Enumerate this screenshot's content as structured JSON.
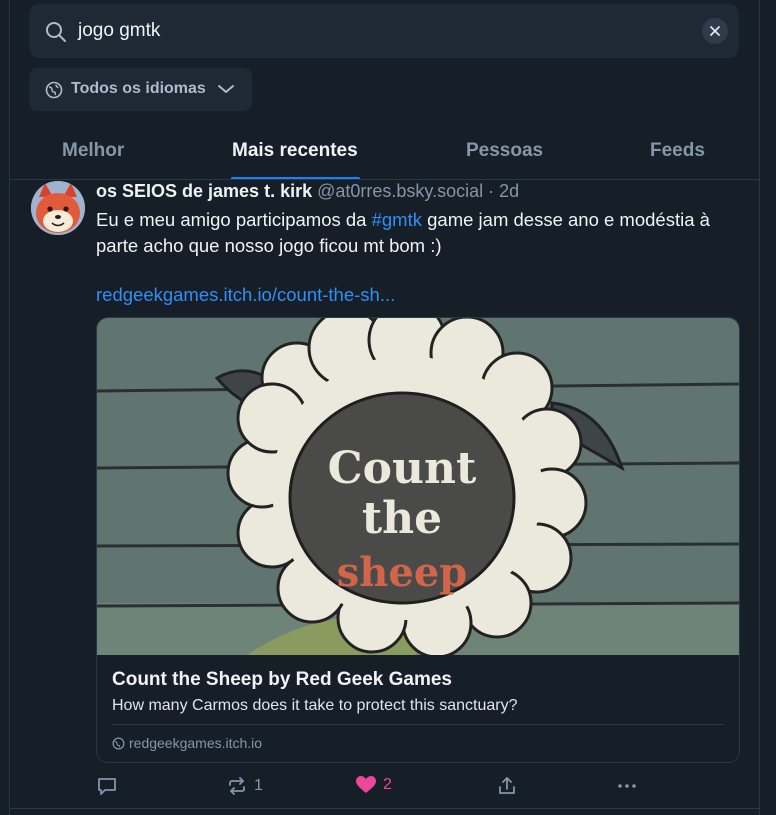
{
  "search": {
    "query": "jogo gmtk",
    "icon": "search-icon",
    "clear_icon": "close-icon"
  },
  "language_filter": {
    "label": "Todos os idiomas",
    "icon": "language-globe-icon"
  },
  "tabs": [
    {
      "label": "Melhor",
      "active": false
    },
    {
      "label": "Mais recentes",
      "active": true
    },
    {
      "label": "Pessoas",
      "active": false
    },
    {
      "label": "Feeds",
      "active": false
    }
  ],
  "post": {
    "display_name": "os SEIOS de james t. kirk",
    "handle": "@at0rres.bsky.social",
    "time_separator": "·",
    "time": "2d",
    "text_before_tag": "Eu e meu amigo participamos da ",
    "hashtag": "#gmtk",
    "text_after_tag": " game jam desse ano e modéstia à parte acho que nosso jogo ficou mt bom :)",
    "link": "redgeekgames.itch.io/count-the-sh...",
    "embed": {
      "image_text": [
        "Count",
        "the",
        "sheep"
      ],
      "title": "Count the Sheep by Red Geek Games",
      "description": "How many Carmos does it take to protect this sanctuary?",
      "domain": "redgeekgames.itch.io"
    },
    "actions": {
      "reply_count": "",
      "repost_count": "1",
      "like_count": "2",
      "liked": true
    }
  },
  "colors": {
    "background": "#161e27",
    "surface": "#1e2936",
    "accent": "#1083fe",
    "link": "#2f8ff5",
    "like": "#ec4899",
    "muted": "#8396aa"
  }
}
